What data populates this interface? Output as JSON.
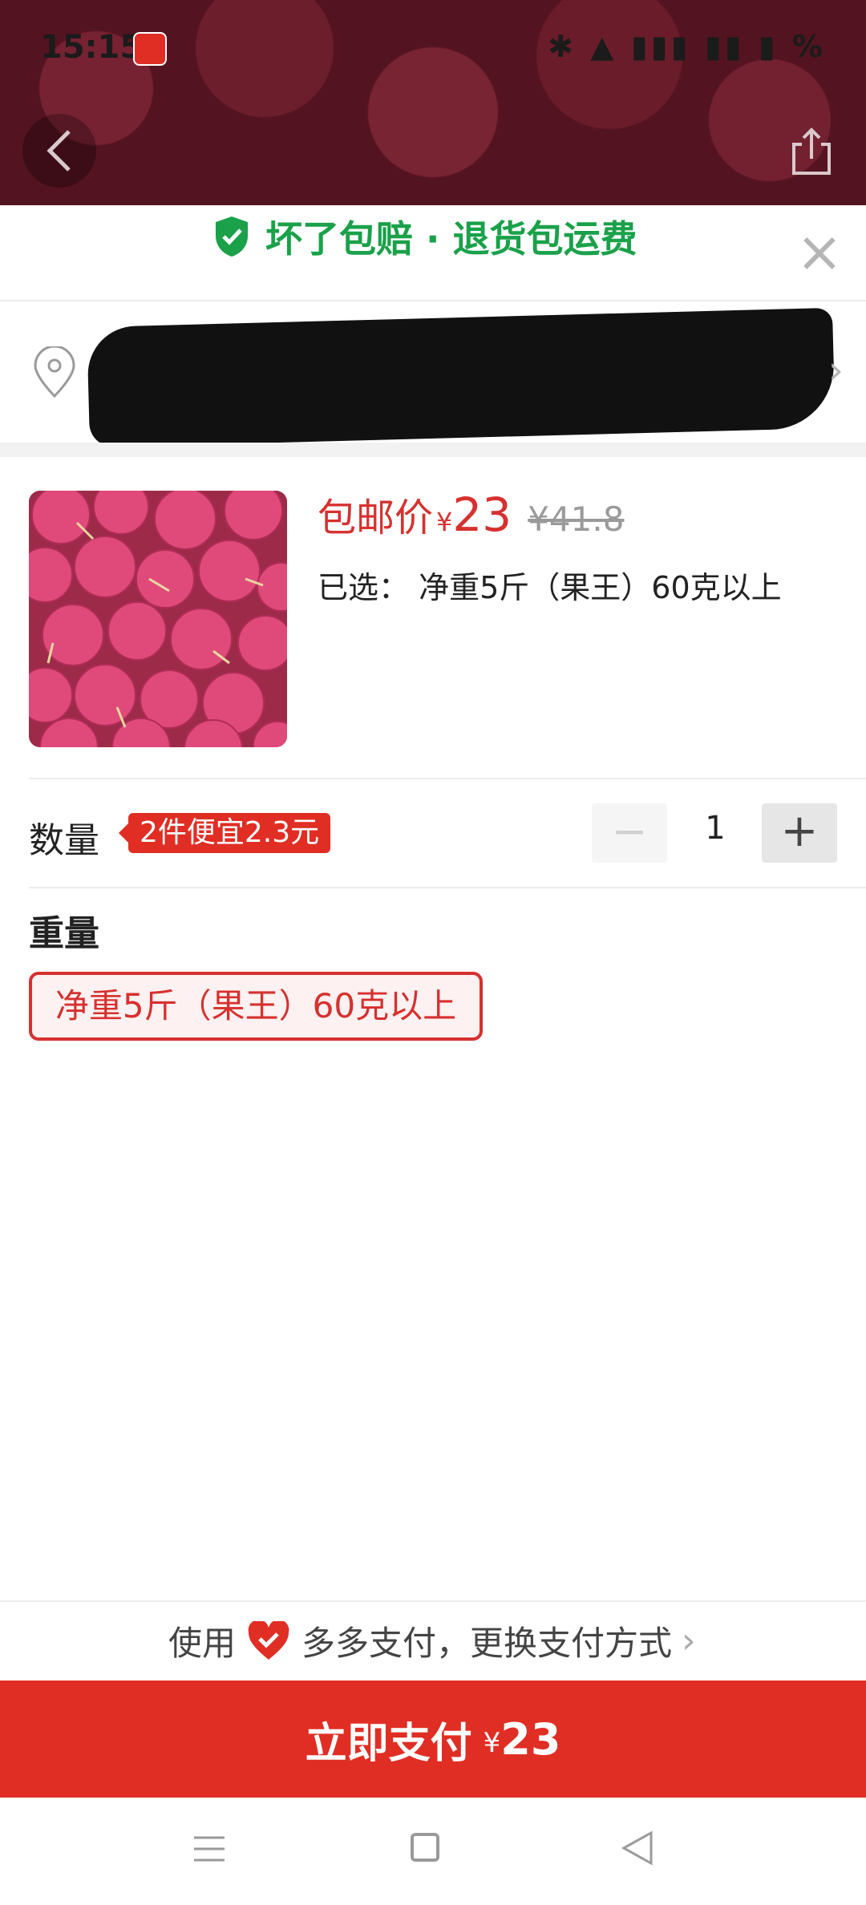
{
  "status_bar": {
    "time": "15:15",
    "right_icons": "✱ ▲ ▮▮▮ ▮▮ ▮ %"
  },
  "header": {
    "guarantee_text": "坏了包赔 · 退货包运费",
    "close_glyph": "×"
  },
  "address": {
    "redacted": true
  },
  "product": {
    "price_label": "包邮价",
    "currency": "¥",
    "price": "23",
    "original_price": "¥41.8",
    "selected_label": "已选：",
    "selected_value": "净重5斤（果王）60克以上"
  },
  "quantity": {
    "label": "数量",
    "promo": "2件便宜2.3元",
    "minus": "−",
    "value": "1",
    "plus": "+"
  },
  "weight": {
    "title": "重量",
    "options": [
      "净重5斤（果王）60克以上"
    ]
  },
  "payment": {
    "prefix": "使用",
    "method": "多多支付，更换支付方式",
    "chevron": "›"
  },
  "pay_button": {
    "label": "立即支付",
    "currency": "¥",
    "amount": "23"
  },
  "icons": [
    "back-icon",
    "share-icon",
    "shield-check-icon",
    "close-icon",
    "location-pin-icon",
    "chevron-right-icon",
    "heart-icon",
    "menu-icon",
    "home-icon",
    "back-nav-icon"
  ],
  "colors": {
    "accent_red": "#e02e24",
    "price_red": "#d6312f",
    "guarantee_green": "#1aa14a"
  }
}
